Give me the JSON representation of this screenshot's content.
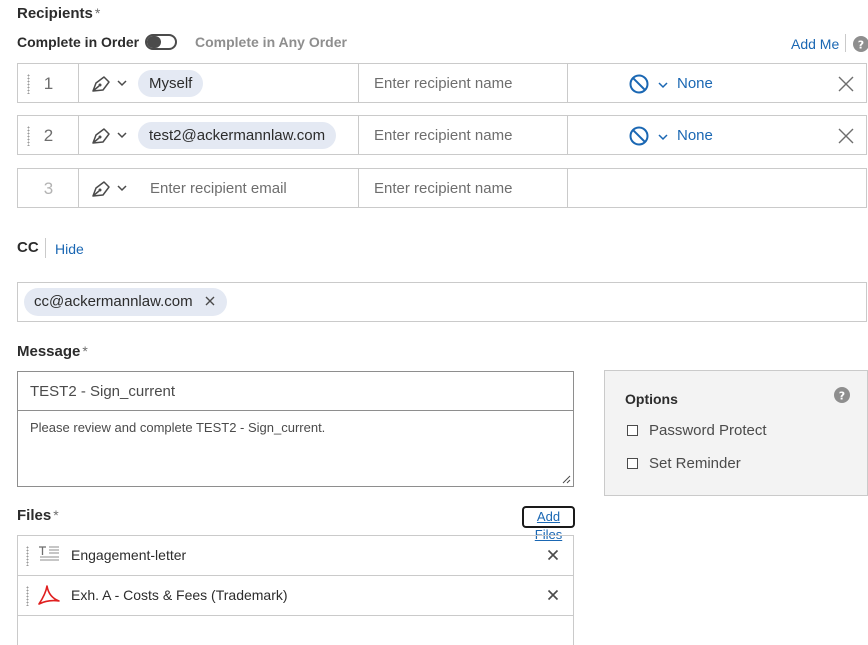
{
  "recipients": {
    "title": "Recipients",
    "required_mark": "*",
    "complete_in_order": "Complete in Order",
    "complete_any_order": "Complete in Any Order",
    "add_me": "Add Me",
    "help_icon": "question-circle-icon",
    "rows": [
      {
        "number": "1",
        "email": "Myself",
        "name_placeholder": "Enter recipient name",
        "auth": "None"
      },
      {
        "number": "2",
        "email": "test2@ackermannlaw.com",
        "name_placeholder": "Enter recipient name",
        "auth": "None"
      },
      {
        "number": "3",
        "email_placeholder": "Enter recipient email",
        "name_placeholder": "Enter recipient name"
      }
    ]
  },
  "cc": {
    "title": "CC",
    "hide": "Hide",
    "chips": [
      "cc@ackermannlaw.com"
    ]
  },
  "message": {
    "title": "Message",
    "required_mark": "*",
    "subject": "TEST2 - Sign_current",
    "body": "Please review and complete TEST2 - Sign_current."
  },
  "options": {
    "title": "Options",
    "password_protect": "Password Protect",
    "set_reminder": "Set Reminder"
  },
  "files": {
    "title": "Files",
    "required_mark": "*",
    "add_files": "Add Files",
    "items": [
      {
        "name": "Engagement-letter",
        "icon": "document-text-icon"
      },
      {
        "name": "Exh. A - Costs & Fees (Trademark)",
        "icon": "pdf-icon"
      }
    ]
  },
  "colors": {
    "link": "#1a67b3",
    "chip": "#e4e9f3",
    "options_bg": "#f3f3f3"
  }
}
